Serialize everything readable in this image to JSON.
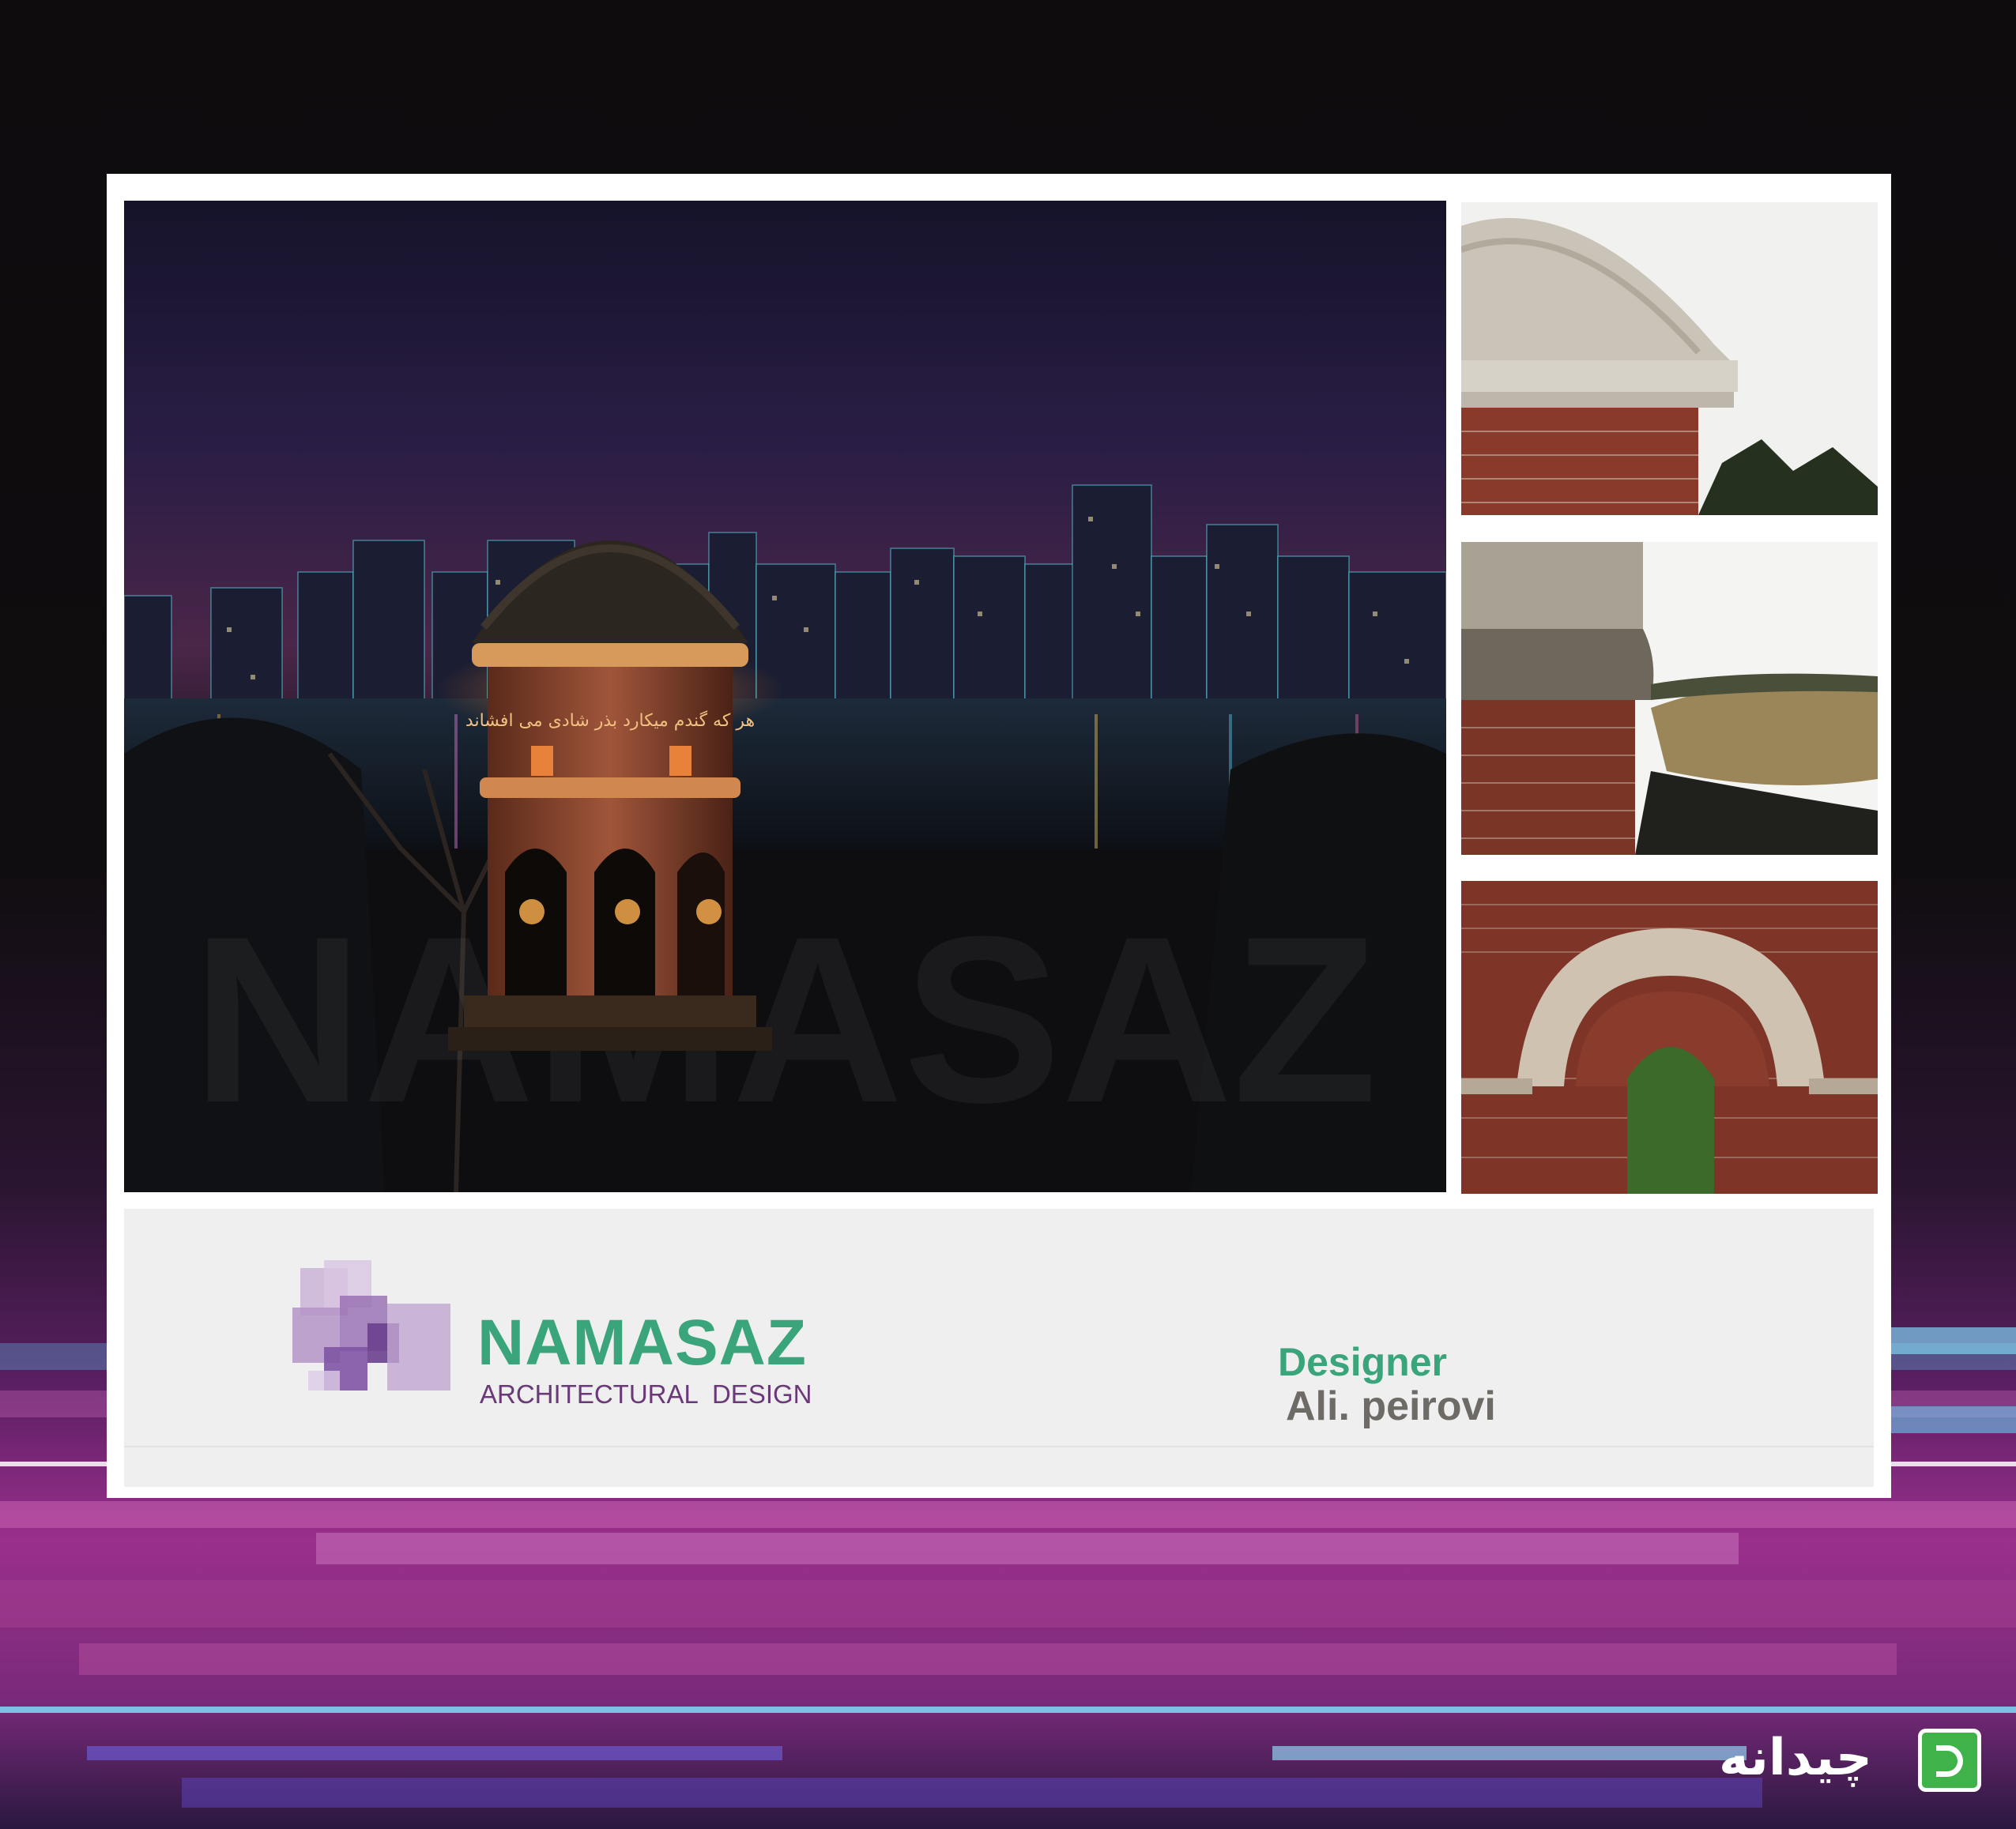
{
  "poster": {
    "inscription": "هر که گندم میکارد بذر شادی می افشاند",
    "watermark": "NAMASAZ",
    "brand_name": "NAMASAZ",
    "brand_tagline": "ARCHITECTURAL  DESIGN",
    "designer_label": "Designer",
    "designer_name": "Ali. peirovi",
    "corner_logo_text": "چیدانه"
  },
  "colors": {
    "brand_green": "#3aa57a",
    "tagline_purple": "#6a3a78",
    "designer_gray": "#6e6a66",
    "background_magenta": "#9a2f8c"
  },
  "images": [
    {
      "name": "main-render-night",
      "content": "domed brick pavilion lit at night in front of a city skyline over water"
    },
    {
      "name": "detail-dome-cornice",
      "content": "stone dome and cornice over brick drum"
    },
    {
      "name": "detail-cornice-side",
      "content": "cornice profile over brick wall with landscape"
    },
    {
      "name": "detail-arch",
      "content": "stone arch in brick wall with greenery"
    }
  ]
}
